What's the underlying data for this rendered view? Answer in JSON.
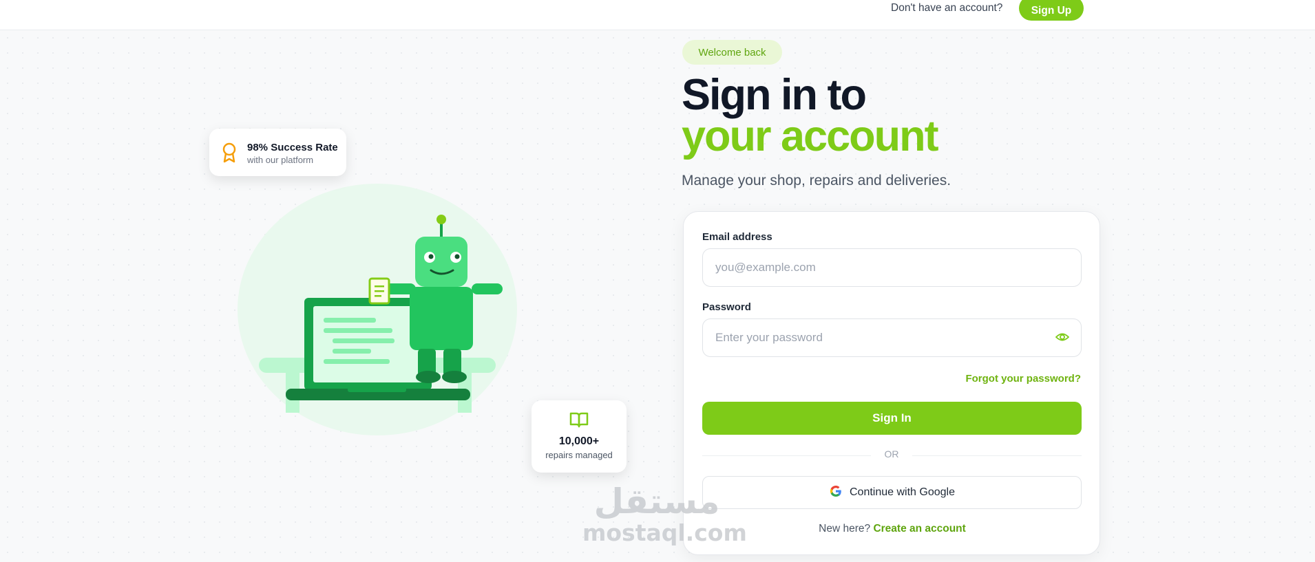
{
  "header": {
    "prompt_text": "Don't have an account?",
    "signup_label": "Sign Up"
  },
  "stats": {
    "success": {
      "title": "98% Success Rate",
      "subtitle": "with our platform"
    },
    "repairs": {
      "title": "10,000+",
      "subtitle": "repairs managed"
    }
  },
  "hero": {
    "badge": "Welcome back",
    "title_line1": "Sign in to",
    "title_line2": "your account",
    "subtitle": "Manage your shop, repairs and deliveries."
  },
  "form": {
    "email_label": "Email address",
    "email_placeholder": "you@example.com",
    "password_label": "Password",
    "password_placeholder": "Enter your password",
    "forgot_label": "Forgot your password?",
    "signin_label": "Sign In",
    "or_label": "OR",
    "google_label": "Continue with Google",
    "new_here": "New here?",
    "create_account": "Create an account"
  },
  "watermark": {
    "arabic": "مستقل",
    "latin": "mostaql.com"
  },
  "colors": {
    "accent": "#7ecb18",
    "accent_dark": "#5fa50f",
    "text_dark": "#111827",
    "robot_green": "#22c55e"
  },
  "icons": [
    "award-icon",
    "book-open-icon",
    "eye-icon",
    "google-icon"
  ]
}
